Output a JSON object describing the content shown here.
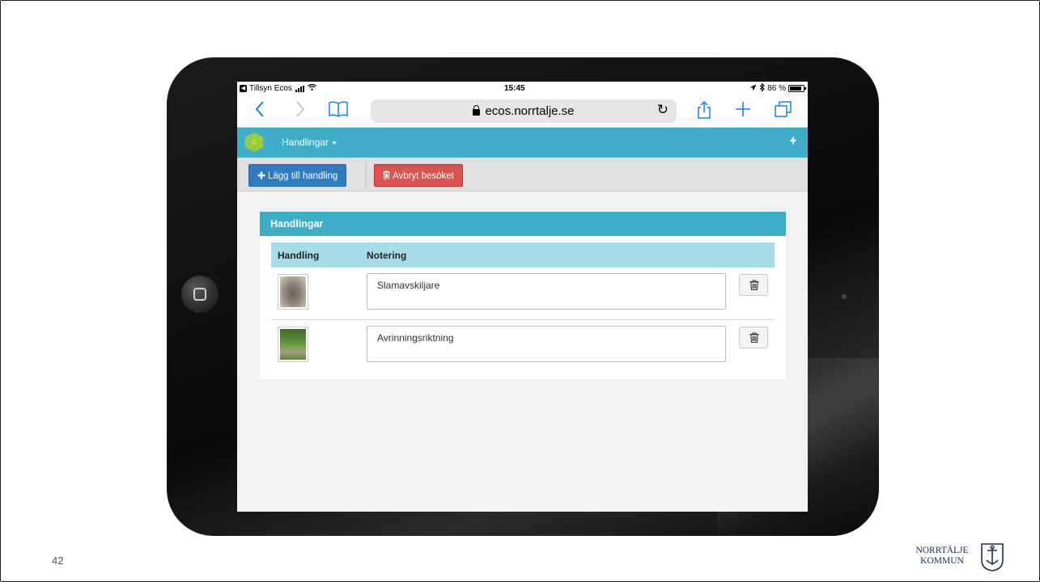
{
  "status_bar": {
    "app_back": "Tillsyn Ecos",
    "time": "15:45",
    "battery": "86 %"
  },
  "browser": {
    "url": "ecos.norrtalje.se"
  },
  "app_nav": {
    "menu_label": "Handlingar",
    "accent_color": "#3eaec8",
    "logo_color": "#9ccc3c"
  },
  "actions": {
    "add_label": "Lägg till handling",
    "cancel_label": "Avbryt besöket"
  },
  "panel": {
    "title": "Handlingar",
    "columns": [
      "Handling",
      "Notering"
    ],
    "rows": [
      {
        "note": "Slamavskiljare",
        "thumbnail": "concrete-well-photo"
      },
      {
        "note": "Avrinningsriktning",
        "thumbnail": "lawn-photo"
      }
    ]
  },
  "slide": {
    "number": "42",
    "brand_line1": "NORRTÄLJE",
    "brand_line2": "KOMMUN"
  }
}
